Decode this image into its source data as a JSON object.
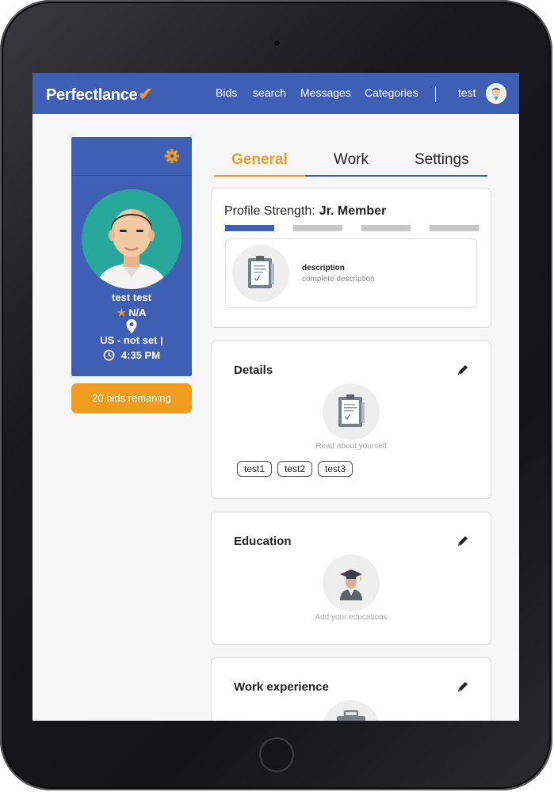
{
  "nav": {
    "brand": "Perfectlance",
    "brand_check": "✔",
    "items": [
      {
        "label": "Bids"
      },
      {
        "label": "search"
      },
      {
        "label": "Messages"
      },
      {
        "label": "Categories"
      }
    ],
    "user": "test"
  },
  "profile": {
    "name": "test test",
    "rating": "N/A",
    "location": "US - not set |",
    "time": "4:35 PM",
    "bids_remaining": "20 bids remaning"
  },
  "tabs": [
    {
      "label": "General",
      "active": true
    },
    {
      "label": "Work",
      "active": false
    },
    {
      "label": "Settings",
      "active": false
    }
  ],
  "strength": {
    "label": "Profile Strength:",
    "level": "Jr. Member",
    "segments_filled": 1,
    "segments_total": 4,
    "card_title": "description",
    "card_sub": "complete description"
  },
  "details": {
    "title": "Details",
    "hint": "Read about yourself",
    "tags": [
      "test1",
      "test2",
      "test3"
    ]
  },
  "education": {
    "title": "Education",
    "hint": "Add your educations"
  },
  "work": {
    "title": "Work experience"
  },
  "colors": {
    "primary": "#3f5fb5",
    "accent": "#f29c1f",
    "segment_empty": "#c7c7c7"
  },
  "icons": [
    "gear-icon",
    "star-icon",
    "location-pin-icon",
    "clock-icon",
    "clipboard-icon",
    "graduate-icon",
    "pencil-icon"
  ]
}
